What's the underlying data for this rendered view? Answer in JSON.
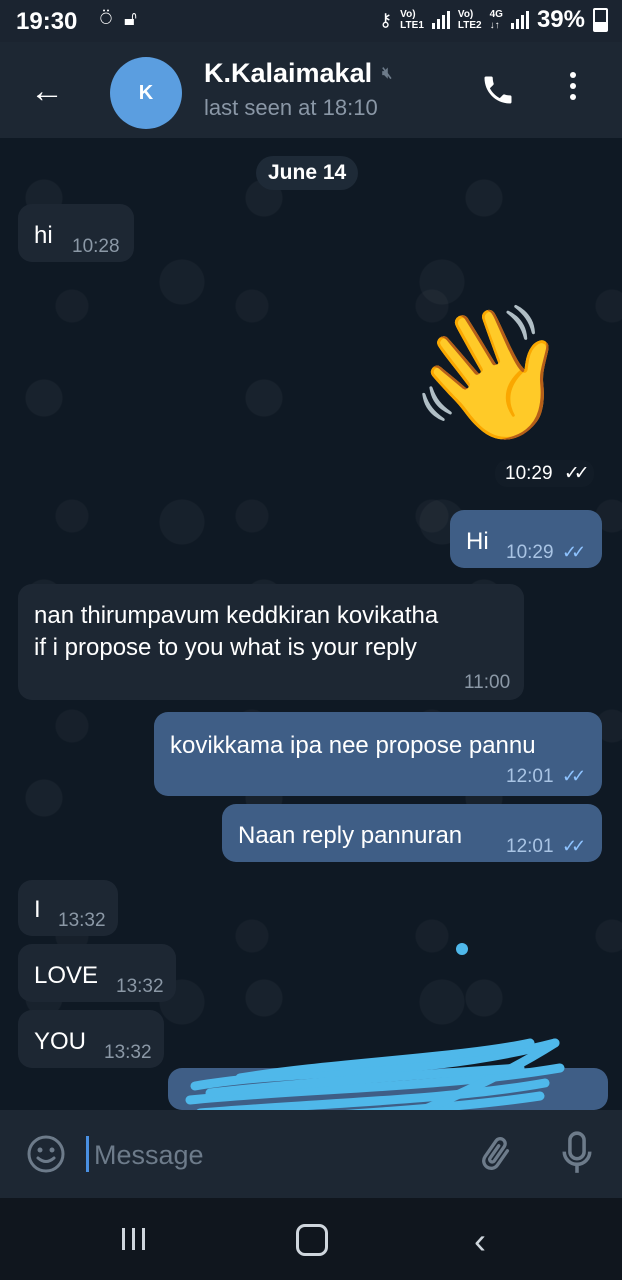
{
  "status_bar": {
    "time": "19:30",
    "battery": "39%",
    "sim1": "LTE1",
    "sim2": "LTE2",
    "network": "4G",
    "volte": "Vo)"
  },
  "header": {
    "avatar_letter": "K",
    "contact_name": "K.Kalaimakal",
    "last_seen": "last seen at 18:10"
  },
  "chat": {
    "date_label": "June 14",
    "messages": [
      {
        "direction": "in",
        "text": "hi",
        "time": "10:28"
      },
      {
        "direction": "out",
        "text": "👋",
        "time": "10:29",
        "type": "emoji"
      },
      {
        "direction": "out",
        "text": "Hi",
        "time": "10:29"
      },
      {
        "direction": "in",
        "text": "nan thirumpavum keddkiran kovikatha",
        "text2": "if i propose to you what is your reply",
        "time": "11:00"
      },
      {
        "direction": "out",
        "text": "kovikkama ipa nee propose pannu",
        "time": "12:01"
      },
      {
        "direction": "out",
        "text": "Naan reply pannuran",
        "time": "12:01"
      },
      {
        "direction": "in",
        "text": "I",
        "time": "13:32"
      },
      {
        "direction": "in",
        "text": "LOVE",
        "time": "13:32"
      },
      {
        "direction": "in",
        "text": "YOU",
        "time": "13:32"
      }
    ],
    "read_ticks": "✓✓"
  },
  "composer": {
    "placeholder": "Message"
  },
  "colors": {
    "background": "#0e1621",
    "incoming": "#1d2733",
    "outgoing": "#3f5e86",
    "accent": "#5b9ee0"
  }
}
